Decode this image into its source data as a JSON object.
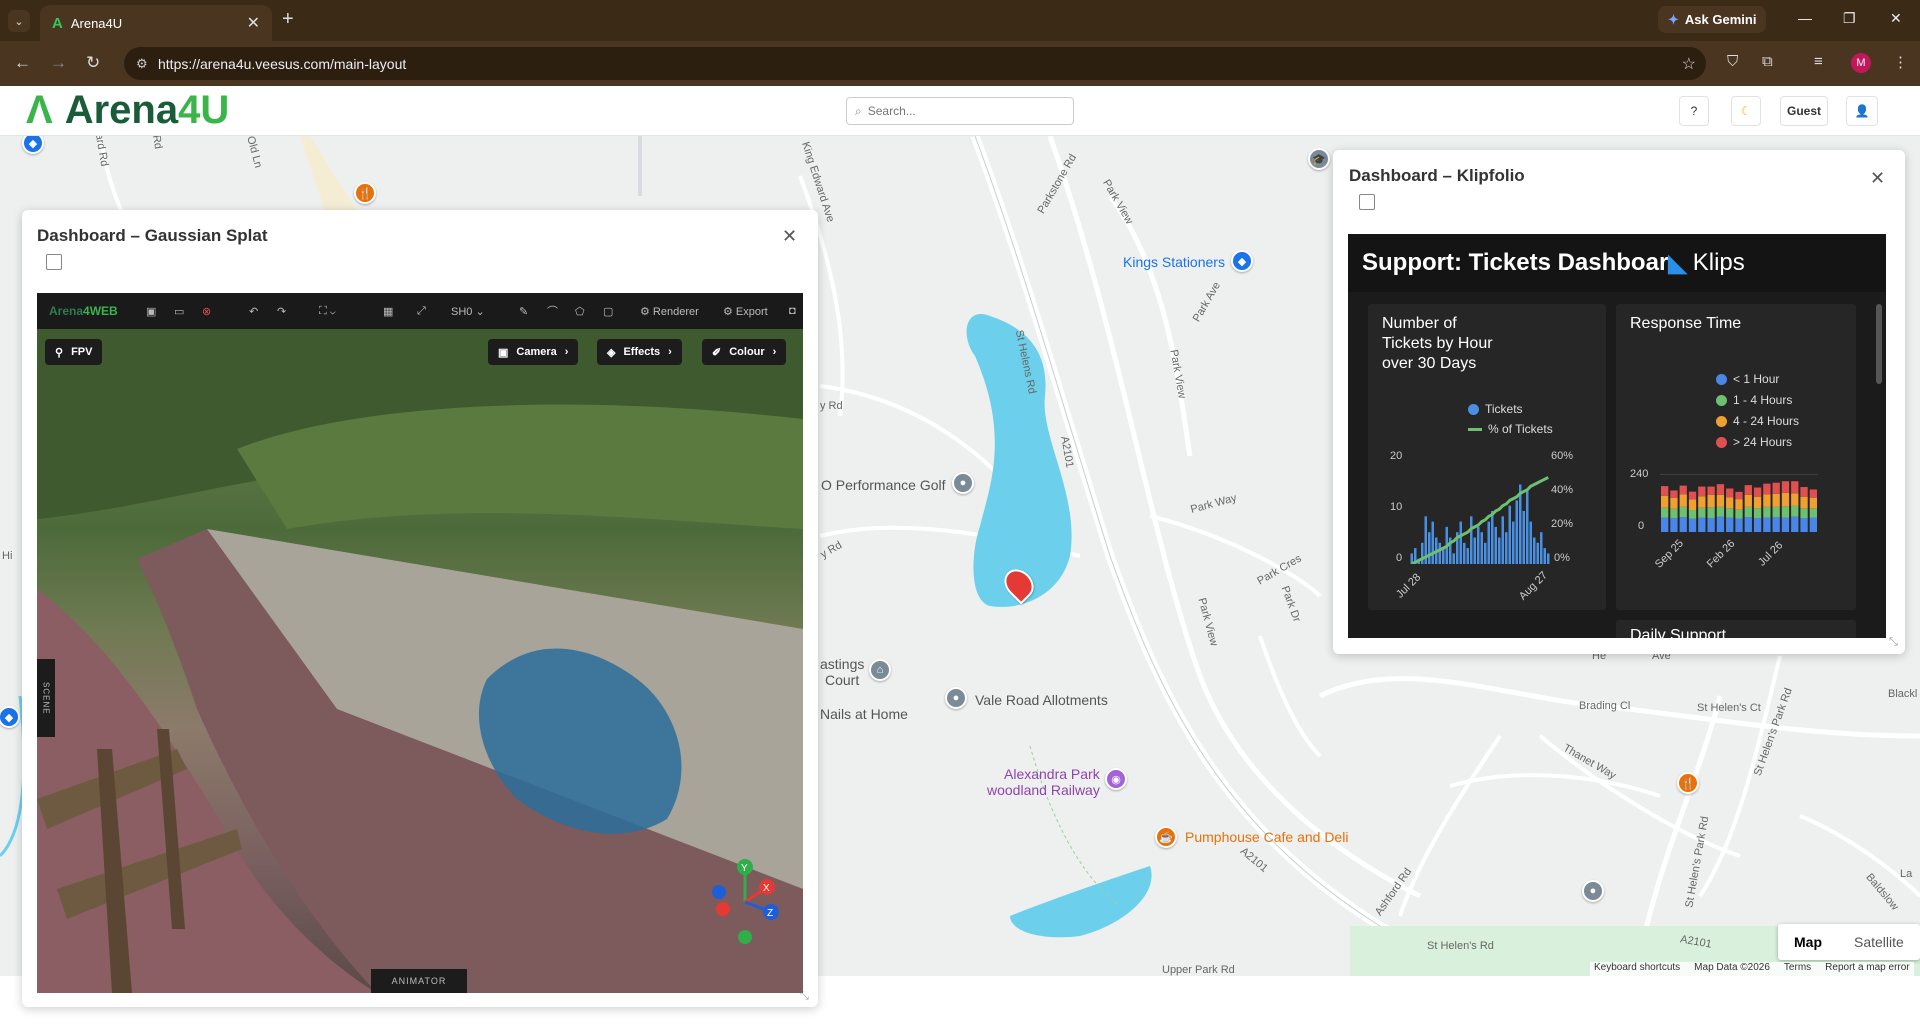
{
  "browser": {
    "tab_title": "Arena4U",
    "url": "https://arena4u.veesus.com/main-layout",
    "gemini_label": "Ask Gemini",
    "profile_initial": "M"
  },
  "header": {
    "logo_text_a": "Arena",
    "logo_text_b": "4U",
    "search_placeholder": "Search...",
    "guest_label": "Guest"
  },
  "map": {
    "labels": {
      "kings_stationers": "Kings Stationers",
      "performance_golf": "O Performance Golf",
      "vale_road": "Vale Road Allotments",
      "nails": "Nails at Home",
      "hastings": "astings",
      "court": "Court",
      "alexandra_1": "Alexandra Park",
      "alexandra_2": "woodland Railway",
      "pumphouse": "Pumphouse Cafe and Deli"
    },
    "roads": {
      "st_helens_rd": "St Helens Rd",
      "parkstone_rd": "Parkstone Rd",
      "king_edward": "King Edward Ave",
      "park_view_1": "Park View",
      "park_view_2": "Park View",
      "park_view_3": "Park View",
      "park_ave": "Park Ave",
      "a2101_1": "A2101",
      "a2101_2": "A2101",
      "a2101_3": "A2101",
      "park_way": "Park Way",
      "park_cres": "Park Cres",
      "park_dr": "Park Dr",
      "brading_cl": "Brading Cl",
      "st_helens_ct": "St Helen's Ct",
      "thanet_way": "Thanet Way",
      "st_helens_park_rd": "St Helen's Park Rd",
      "st_helens_park_rd_2": "St Helen's Park Rd",
      "ashford_rd": "Ashford Rd",
      "st_helens_rd_2": "St Helen's Rd",
      "upper_park_rd": "Upper Park Rd",
      "baldslow": "Baldslow",
      "old_ln": "Old Ln",
      "rd_1": "Rd",
      "rd_2": "ard Rd",
      "rd_3": "y Rd",
      "rd_4": "y Rd",
      "blackl": "Blackl",
      "la": "La",
      "hi": "Hi",
      "hie": "He",
      "ave": "Ave"
    },
    "toggle_map": "Map",
    "toggle_satellite": "Satellite",
    "footer": {
      "shortcuts": "Keyboard shortcuts",
      "data": "Map Data ©2026",
      "terms": "Terms",
      "report": "Report a map error"
    }
  },
  "splat_panel": {
    "title": "Dashboard – Gaussian Splat",
    "toolbar": {
      "logo_a": "Arena",
      "logo_b": "4WEB",
      "sh_label": "SH0",
      "renderer": "Renderer",
      "export": "Export"
    },
    "fpv": "FPV",
    "camera": "Camera",
    "effects": "Effects",
    "colour": "Colour",
    "animator": "ANIMATOR",
    "scene_tab": "SCENE"
  },
  "klip_panel": {
    "title": "Dashboard – Klipfolio",
    "dashboard_title": "Support: Tickets Dashboar",
    "klips_label": "Klips",
    "card1": {
      "title_1": "Number of",
      "title_2": "Tickets by Hour",
      "title_3": "over 30 Days",
      "legend_tickets": "Tickets",
      "legend_pct": "% of Tickets",
      "y_ticks": [
        "20",
        "10",
        "0"
      ],
      "y2_ticks": [
        "60%",
        "40%",
        "20%",
        "0%"
      ],
      "x_ticks": [
        "Jul 28",
        "Aug 27"
      ]
    },
    "card2": {
      "title": "Response Time",
      "legend": [
        "< 1 Hour",
        "1 - 4 Hours",
        "4 - 24 Hours",
        "> 24 Hours"
      ],
      "y_ticks": [
        "240",
        "0"
      ],
      "x_ticks": [
        "Sep 25",
        "Feb 26",
        "Jul 26"
      ]
    },
    "next_card": "Daily Support"
  },
  "colors": {
    "brand_green": "#39b54a",
    "tickets_blue": "#4a90e2",
    "pct_green": "#6cc070",
    "lt1": "#4a86e8",
    "h14": "#6cc070",
    "h424": "#f0a030",
    "gt24": "#e05050"
  },
  "chart_data": [
    {
      "type": "bar",
      "title": "Number of Tickets by Hour over 30 Days",
      "series": [
        {
          "name": "Tickets",
          "values": [
            2,
            3,
            1,
            4,
            9,
            6,
            8,
            5,
            4,
            3,
            7,
            5,
            2,
            6,
            8,
            4,
            3,
            9,
            5,
            7,
            6,
            4,
            8,
            10,
            7,
            5,
            9,
            6,
            11,
            8,
            12,
            15,
            10,
            14,
            8,
            5,
            4,
            6,
            3,
            2
          ]
        },
        {
          "name": "% of Tickets",
          "values": [
            0,
            1,
            2,
            3,
            4,
            5,
            6,
            7,
            8,
            9,
            10,
            12,
            13,
            15,
            16,
            17,
            18,
            20,
            21,
            22,
            24,
            25,
            27,
            28,
            30,
            31,
            33,
            34,
            36,
            37,
            38,
            40,
            41,
            42,
            44,
            45,
            46,
            47,
            48,
            49
          ]
        }
      ],
      "ylim": [
        0,
        20
      ],
      "y2lim": [
        0,
        60
      ],
      "x_ticks": [
        "Jul 28",
        "Aug 27"
      ]
    },
    {
      "type": "bar",
      "title": "Response Time",
      "categories_count": 17,
      "series": [
        {
          "name": "< 1 Hour",
          "values": [
            60,
            58,
            62,
            55,
            60,
            58,
            64,
            60,
            56,
            62,
            58,
            60,
            62,
            60,
            64,
            58,
            60
          ]
        },
        {
          "name": "1 - 4 Hours",
          "values": [
            40,
            38,
            42,
            36,
            40,
            44,
            40,
            38,
            36,
            42,
            40,
            44,
            42,
            46,
            44,
            40,
            38
          ]
        },
        {
          "name": "4 - 24 Hours",
          "values": [
            50,
            46,
            52,
            44,
            48,
            52,
            50,
            46,
            44,
            50,
            48,
            52,
            54,
            56,
            52,
            48,
            44
          ]
        },
        {
          "name": "> 24 Hours",
          "values": [
            40,
            30,
            36,
            32,
            40,
            34,
            44,
            36,
            30,
            40,
            38,
            44,
            46,
            48,
            50,
            40,
            34
          ]
        }
      ],
      "ylim": [
        0,
        240
      ],
      "x_ticks": [
        "Sep 25",
        "Feb 26",
        "Jul 26"
      ]
    }
  ]
}
